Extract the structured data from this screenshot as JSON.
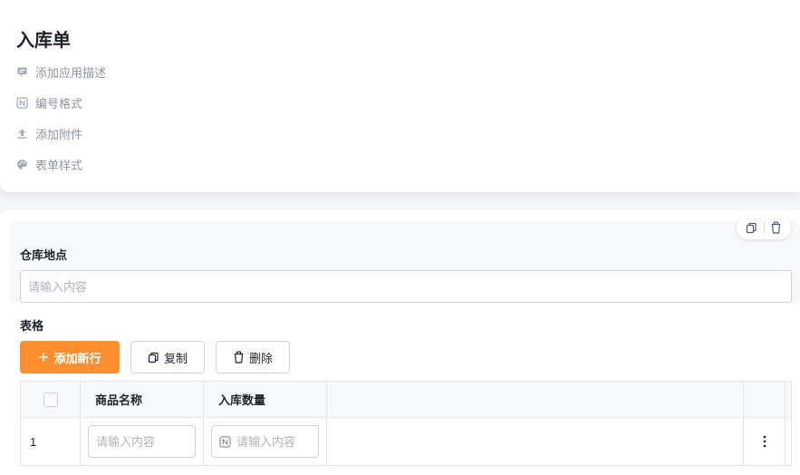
{
  "form": {
    "title": "入库单",
    "meta_items": [
      {
        "icon": "comment-icon",
        "label": "添加应用描述"
      },
      {
        "icon": "number-format-icon",
        "label": "编号格式"
      },
      {
        "icon": "upload-icon",
        "label": "添加附件"
      },
      {
        "icon": "palette-icon",
        "label": "表单样式"
      }
    ]
  },
  "warehouse_field": {
    "label": "仓库地点",
    "placeholder": "请输入内容",
    "value": "",
    "tools": [
      "copy-icon",
      "trash-icon"
    ]
  },
  "table": {
    "label": "表格",
    "add_button": "添加新行",
    "copy_button": "复制",
    "delete_button": "删除",
    "columns": [
      "商品名称",
      "入库数量"
    ],
    "rows": [
      {
        "index": "1",
        "product_name_placeholder": "请输入内容",
        "quantity_placeholder": "请输入内容"
      }
    ]
  },
  "colors": {
    "accent": "#ff8f2e",
    "muted_text": "#8f959e",
    "border": "#d0d3d6"
  }
}
